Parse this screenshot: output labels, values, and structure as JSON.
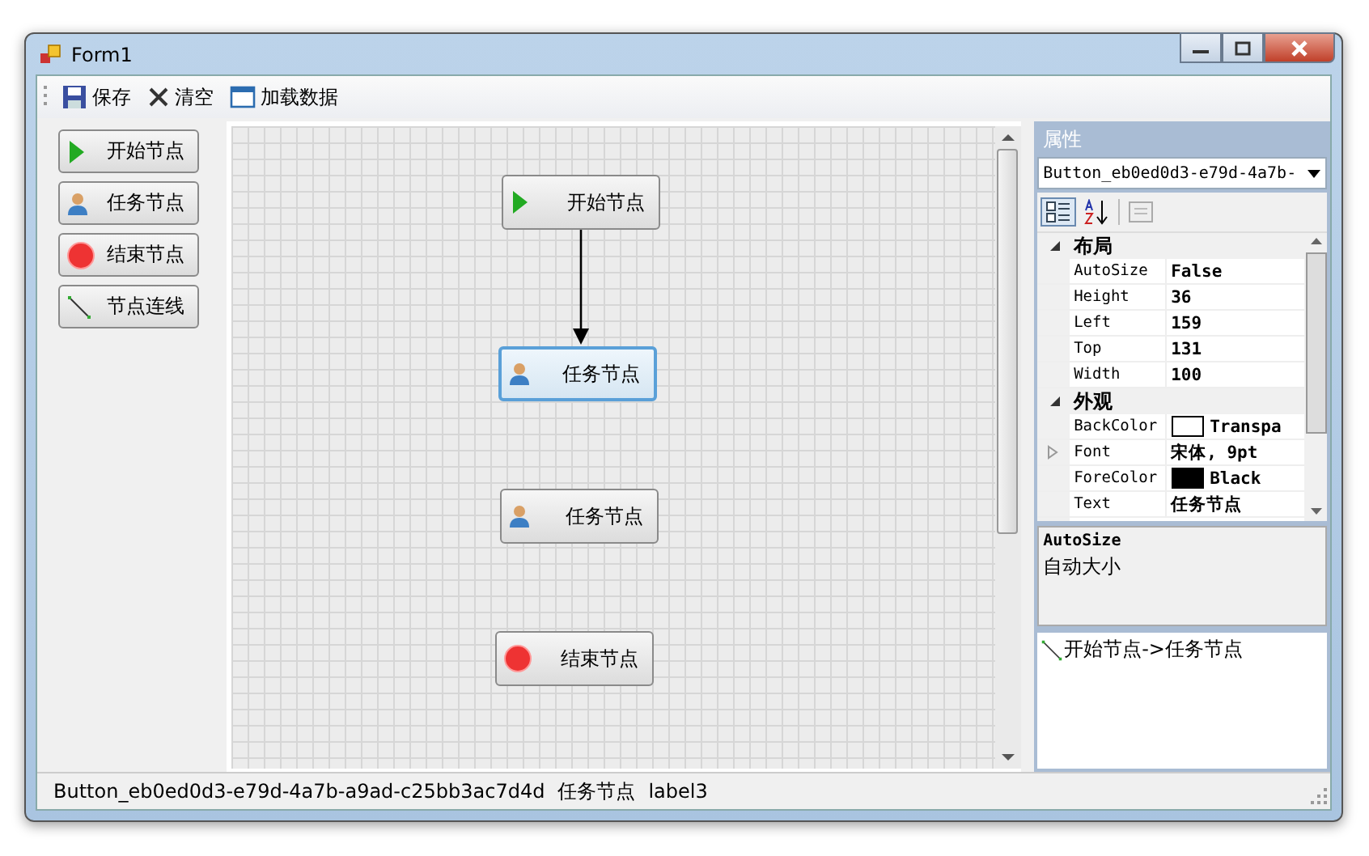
{
  "window": {
    "title": "Form1"
  },
  "toolbar": [
    {
      "label": "保存",
      "kind": "save"
    },
    {
      "label": "清空",
      "kind": "clear"
    },
    {
      "label": "加载数据",
      "kind": "load"
    }
  ],
  "palette": [
    {
      "label": "开始节点",
      "kind": "start"
    },
    {
      "label": "任务节点",
      "kind": "task"
    },
    {
      "label": "结束节点",
      "kind": "end"
    },
    {
      "label": "节点连线",
      "kind": "line"
    }
  ],
  "canvas": {
    "nodes": [
      {
        "label": "开始节点",
        "kind": "start",
        "selected": false
      },
      {
        "label": "任务节点",
        "kind": "task",
        "selected": true
      },
      {
        "label": "任务节点",
        "kind": "task",
        "selected": false
      },
      {
        "label": "结束节点",
        "kind": "end",
        "selected": false
      }
    ]
  },
  "properties": {
    "title": "属性",
    "object": "Button_eb0ed0d3-e79d-4a7b-",
    "categories": [
      {
        "name": "布局",
        "expanded": true,
        "rows": [
          {
            "name": "AutoSize",
            "value": "False"
          },
          {
            "name": "Height",
            "value": "36"
          },
          {
            "name": "Left",
            "value": "159"
          },
          {
            "name": "Top",
            "value": "131"
          },
          {
            "name": "Width",
            "value": "100"
          }
        ]
      },
      {
        "name": "外观",
        "expanded": true,
        "rows": [
          {
            "name": "BackColor",
            "value": "Transpa",
            "color": "#ffffff"
          },
          {
            "name": "Font",
            "value": "宋体, 9pt",
            "expandable": true
          },
          {
            "name": "ForeColor",
            "value": "Black",
            "color": "#000000"
          },
          {
            "name": "Text",
            "value": "任务节点"
          }
        ]
      }
    ],
    "description": {
      "title": "AutoSize",
      "text": "自动大小"
    },
    "links": [
      {
        "label": "开始节点->任务节点"
      }
    ]
  },
  "status_bar": [
    "Button_eb0ed0d3-e79d-4a7b-a9ad-c25bb3ac7d4d",
    "任务节点",
    "label3"
  ]
}
